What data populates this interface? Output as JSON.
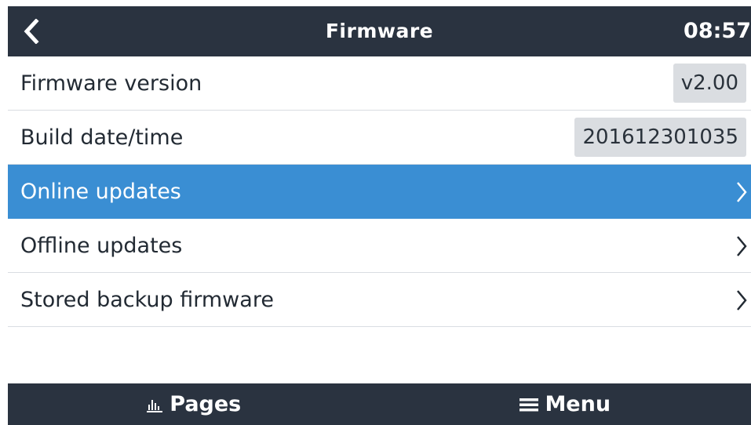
{
  "header": {
    "title": "Firmware",
    "time": "08:57",
    "back_icon": "chevron-left-icon"
  },
  "rows": [
    {
      "label": "Firmware version",
      "value": "v2.00"
    },
    {
      "label": "Build date/time",
      "value": "201612301035"
    },
    {
      "label": "Online updates",
      "selected": true,
      "icon": "chevron-right-icon"
    },
    {
      "label": "Offline updates",
      "icon": "chevron-right-icon"
    },
    {
      "label": "Stored backup firmware",
      "icon": "chevron-right-icon"
    }
  ],
  "footer": {
    "pages_label": "Pages",
    "pages_icon": "bar-chart-icon",
    "menu_label": "Menu",
    "menu_icon": "hamburger-menu-icon"
  },
  "colors": {
    "header_bg": "#2a3340",
    "selected_bg": "#3a8ed3",
    "value_box_bg": "#dadde1"
  }
}
